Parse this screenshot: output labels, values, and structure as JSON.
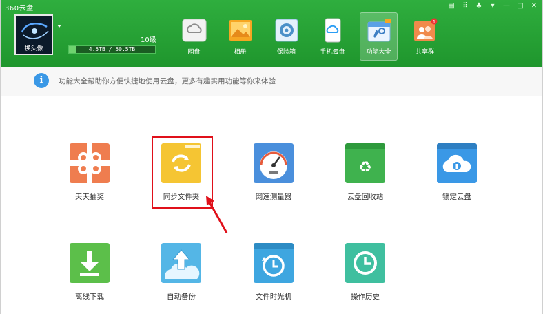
{
  "window": {
    "title": "360云盘",
    "controls": [
      "menu-icon",
      "skin-icon",
      "shirt-icon",
      "dropdown-icon",
      "minimize-icon",
      "maximize-icon",
      "close-icon"
    ]
  },
  "user": {
    "avatar_label": "换头像",
    "level": "10级",
    "storage_text": "4.5TB / 50.5TB",
    "storage_used_fraction": 0.09
  },
  "nav": {
    "items": [
      {
        "label": "网盘",
        "icon": "cloud-disk-icon",
        "active": false
      },
      {
        "label": "相册",
        "icon": "photo-album-icon",
        "active": false
      },
      {
        "label": "保险箱",
        "icon": "safe-box-icon",
        "active": false
      },
      {
        "label": "手机云盘",
        "icon": "mobile-cloud-icon",
        "active": false
      },
      {
        "label": "功能大全",
        "icon": "toolbox-icon",
        "active": true
      },
      {
        "label": "共享群",
        "icon": "share-group-icon",
        "active": false
      }
    ]
  },
  "info": {
    "text": "功能大全帮助你方便快捷地使用云盘，更多有趣实用功能等你来体验"
  },
  "tools": {
    "lottery": "天天抽奖",
    "sync_folder": "同步文件夹",
    "speed_test": "网速测量器",
    "recycle_bin": "云盘回收站",
    "lock_disk": "锁定云盘",
    "offline_download": "离线下载",
    "auto_backup": "自动备份",
    "time_machine": "文件时光机",
    "history": "操作历史"
  },
  "colors": {
    "header_green": "#2fae3e",
    "lottery_orange": "#ef7d4f",
    "sync_yellow": "#f5c533",
    "speed_blue": "#4a8fdc",
    "recycle_green": "#3fb24e",
    "lock_blue": "#3a98e6",
    "download_green": "#5cbf4a",
    "backup_cyan": "#54b6e6",
    "timemachine_blue": "#3ea6e0",
    "history_teal": "#3fbf9f",
    "highlight_red": "#e0101a"
  }
}
